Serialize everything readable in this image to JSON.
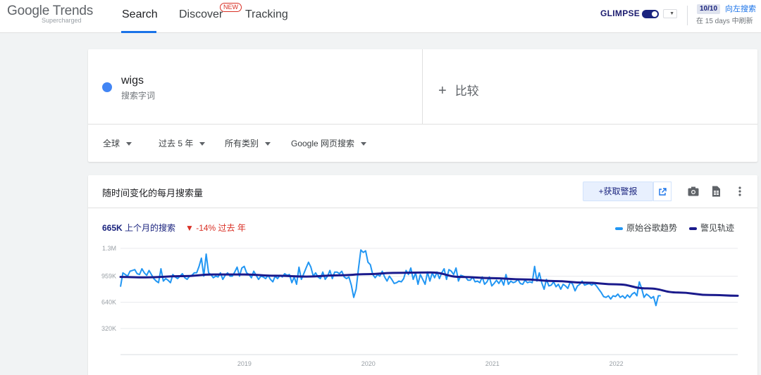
{
  "header": {
    "logo": "Google Trends",
    "logo_sub": "Supercharged",
    "tabs": [
      {
        "label": "Search",
        "active": true
      },
      {
        "label": "Discover",
        "badge": "NEW"
      },
      {
        "label": "Tracking"
      }
    ],
    "glimpse_label": "GLIMPSE",
    "quota": "10/10",
    "quota_link": "向左搜索",
    "refresh_text": "在 15 days 中刷新"
  },
  "search": {
    "term": "wigs",
    "term_type": "搜索字词",
    "term_color": "#4285f4",
    "compare_label": "比较",
    "filters": [
      "全球",
      "过去 5 年",
      "所有类别",
      "Google 网页搜索"
    ]
  },
  "chart_card": {
    "title": "随时间变化的每月搜索量",
    "alert_button": "+获取警报",
    "stat_value": "665K",
    "stat_label": "上个月的搜索",
    "change": "▼ -14% 过去 年",
    "legend": [
      {
        "name": "原始谷歌趋势",
        "color": "#2196f3"
      },
      {
        "name": "警见轨迹",
        "color": "#1a1a8c"
      }
    ]
  },
  "chart_data": {
    "type": "line",
    "y_ticks": [
      {
        "label": "1.3M",
        "value": 1300000
      },
      {
        "label": "959K",
        "value": 959000
      },
      {
        "label": "640K",
        "value": 640000
      },
      {
        "label": "320K",
        "value": 320000
      }
    ],
    "ylim": [
      0,
      1300000
    ],
    "x_ticks": [
      {
        "label": "2019",
        "x": 2019.0
      },
      {
        "label": "2020",
        "x": 2020.0
      },
      {
        "label": "2021",
        "x": 2021.0
      },
      {
        "label": "2022",
        "x": 2022.0
      }
    ],
    "xlim": [
      2018.0,
      2022.98
    ],
    "series": [
      {
        "name": "原始谷歌趋势",
        "color": "#2196f3",
        "x_start": 2018.0,
        "x_step": 0.0192,
        "values": [
          830000,
          1000000,
          980000,
          960000,
          1020000,
          1030000,
          1040000,
          990000,
          980000,
          1050000,
          1000000,
          970000,
          1030000,
          980000,
          930000,
          900000,
          880000,
          1050000,
          900000,
          930000,
          910000,
          880000,
          980000,
          950000,
          930000,
          960000,
          990000,
          940000,
          920000,
          960000,
          970000,
          1000000,
          1000000,
          1080000,
          1180000,
          960000,
          1230000,
          1000000,
          980000,
          940000,
          960000,
          950000,
          1000000,
          920000,
          970000,
          1000000,
          960000,
          960000,
          1010000,
          1070000,
          960000,
          1060000,
          1080000,
          1000000,
          980000,
          940000,
          1020000,
          970000,
          920000,
          960000,
          950000,
          930000,
          970000,
          920000,
          890000,
          960000,
          930000,
          970000,
          950000,
          990000,
          970000,
          980000,
          880000,
          950000,
          860000,
          1070000,
          920000,
          990000,
          1060000,
          1130000,
          1070000,
          960000,
          1000000,
          950000,
          930000,
          1010000,
          920000,
          960000,
          1030000,
          930000,
          1010000,
          1010000,
          990000,
          1020000,
          950000,
          930000,
          950000,
          850000,
          700000,
          800000,
          1050000,
          1280000,
          1250000,
          1270000,
          1130000,
          1100000,
          980000,
          940000,
          980000,
          960000,
          1020000,
          950000,
          900000,
          960000,
          920000,
          870000,
          880000,
          900000,
          890000,
          930000,
          1030000,
          980000,
          1060000,
          920000,
          1000000,
          860000,
          980000,
          920000,
          860000,
          1010000,
          900000,
          1000000,
          940000,
          1010000,
          930000,
          1000000,
          1050000,
          920000,
          1040000,
          1020000,
          980000,
          1060000,
          900000,
          970000,
          960000,
          950000,
          910000,
          910000,
          950000,
          890000,
          900000,
          880000,
          950000,
          860000,
          890000,
          950000,
          840000,
          870000,
          910000,
          870000,
          920000,
          850000,
          980000,
          860000,
          900000,
          880000,
          890000,
          920000,
          870000,
          860000,
          910000,
          880000,
          890000,
          880000,
          1080000,
          900000,
          1000000,
          880000,
          800000,
          920000,
          840000,
          850000,
          890000,
          830000,
          860000,
          800000,
          860000,
          840000,
          810000,
          890000,
          860000,
          780000,
          840000,
          860000,
          900000,
          850000,
          860000,
          870000,
          850000,
          870000,
          840000,
          800000,
          760000,
          710000,
          700000,
          720000,
          680000,
          720000,
          710000,
          740000,
          700000,
          720000,
          690000,
          730000,
          700000,
          740000,
          760000,
          720000,
          890000,
          810000,
          700000,
          740000,
          720000,
          690000,
          710000,
          600000,
          720000,
          720000
        ]
      },
      {
        "name": "警见轨迹",
        "color": "#1a1a8c",
        "points": [
          [
            2018.0,
            950000
          ],
          [
            2018.2,
            945000
          ],
          [
            2018.5,
            960000
          ],
          [
            2018.75,
            980000
          ],
          [
            2019.0,
            980000
          ],
          [
            2019.25,
            965000
          ],
          [
            2019.5,
            955000
          ],
          [
            2019.75,
            970000
          ],
          [
            2020.0,
            985000
          ],
          [
            2020.2,
            1000000
          ],
          [
            2020.5,
            1005000
          ],
          [
            2020.75,
            950000
          ],
          [
            2021.0,
            935000
          ],
          [
            2021.25,
            920000
          ],
          [
            2021.5,
            900000
          ],
          [
            2021.75,
            880000
          ],
          [
            2022.0,
            860000
          ],
          [
            2022.25,
            810000
          ],
          [
            2022.5,
            760000
          ],
          [
            2022.75,
            730000
          ],
          [
            2022.98,
            720000
          ]
        ]
      }
    ]
  }
}
